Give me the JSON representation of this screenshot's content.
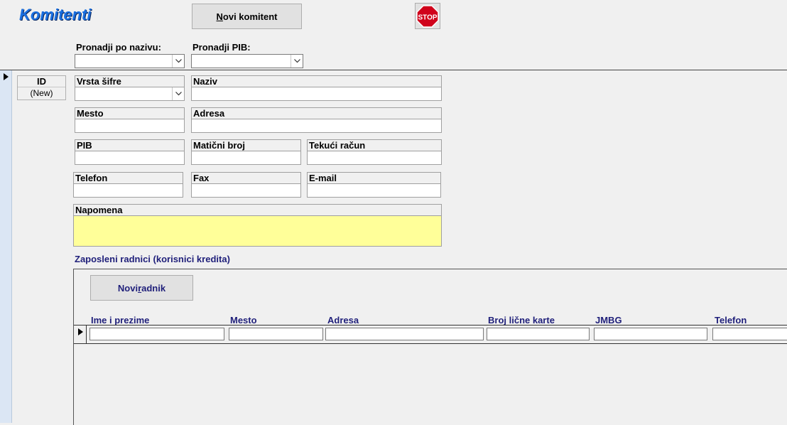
{
  "header": {
    "title": "Komitenti",
    "new_client_button": {
      "underlined": "N",
      "rest": "ovi komitent"
    },
    "stop_label": "STOP",
    "search_by_name_label": "Pronadji po nazivu:",
    "search_by_pib_label": "Pronadji PIB:"
  },
  "record": {
    "id_label": "ID",
    "id_value": "(New)"
  },
  "fields": {
    "vrsta_sifre": "Vrsta šifre",
    "naziv": "Naziv",
    "mesto": "Mesto",
    "adresa": "Adresa",
    "pib": "PIB",
    "maticni_broj": "Matični broj",
    "tekuci_racun": "Tekući račun",
    "telefon": "Telefon",
    "fax": "Fax",
    "email": "E-mail",
    "napomena": "Napomena"
  },
  "subform": {
    "caption": "Zaposleni radnici (korisnici kredita)",
    "new_worker_button": {
      "before": "Novi ",
      "underlined": "r",
      "rest": "adnik"
    },
    "columns": [
      "Ime i prezime",
      "Mesto",
      "Adresa",
      "Broj lične karte",
      "JMBG",
      "Telefon"
    ]
  },
  "colors": {
    "title": "#1a6fe0",
    "note_background": "#ffff99",
    "subform_text": "#1f1f7a",
    "stop_red": "#d0021b"
  },
  "icons": {
    "dropdown": "chevron-down-icon",
    "record_selector": "triangle-right-icon",
    "stop": "stop-sign-icon"
  }
}
